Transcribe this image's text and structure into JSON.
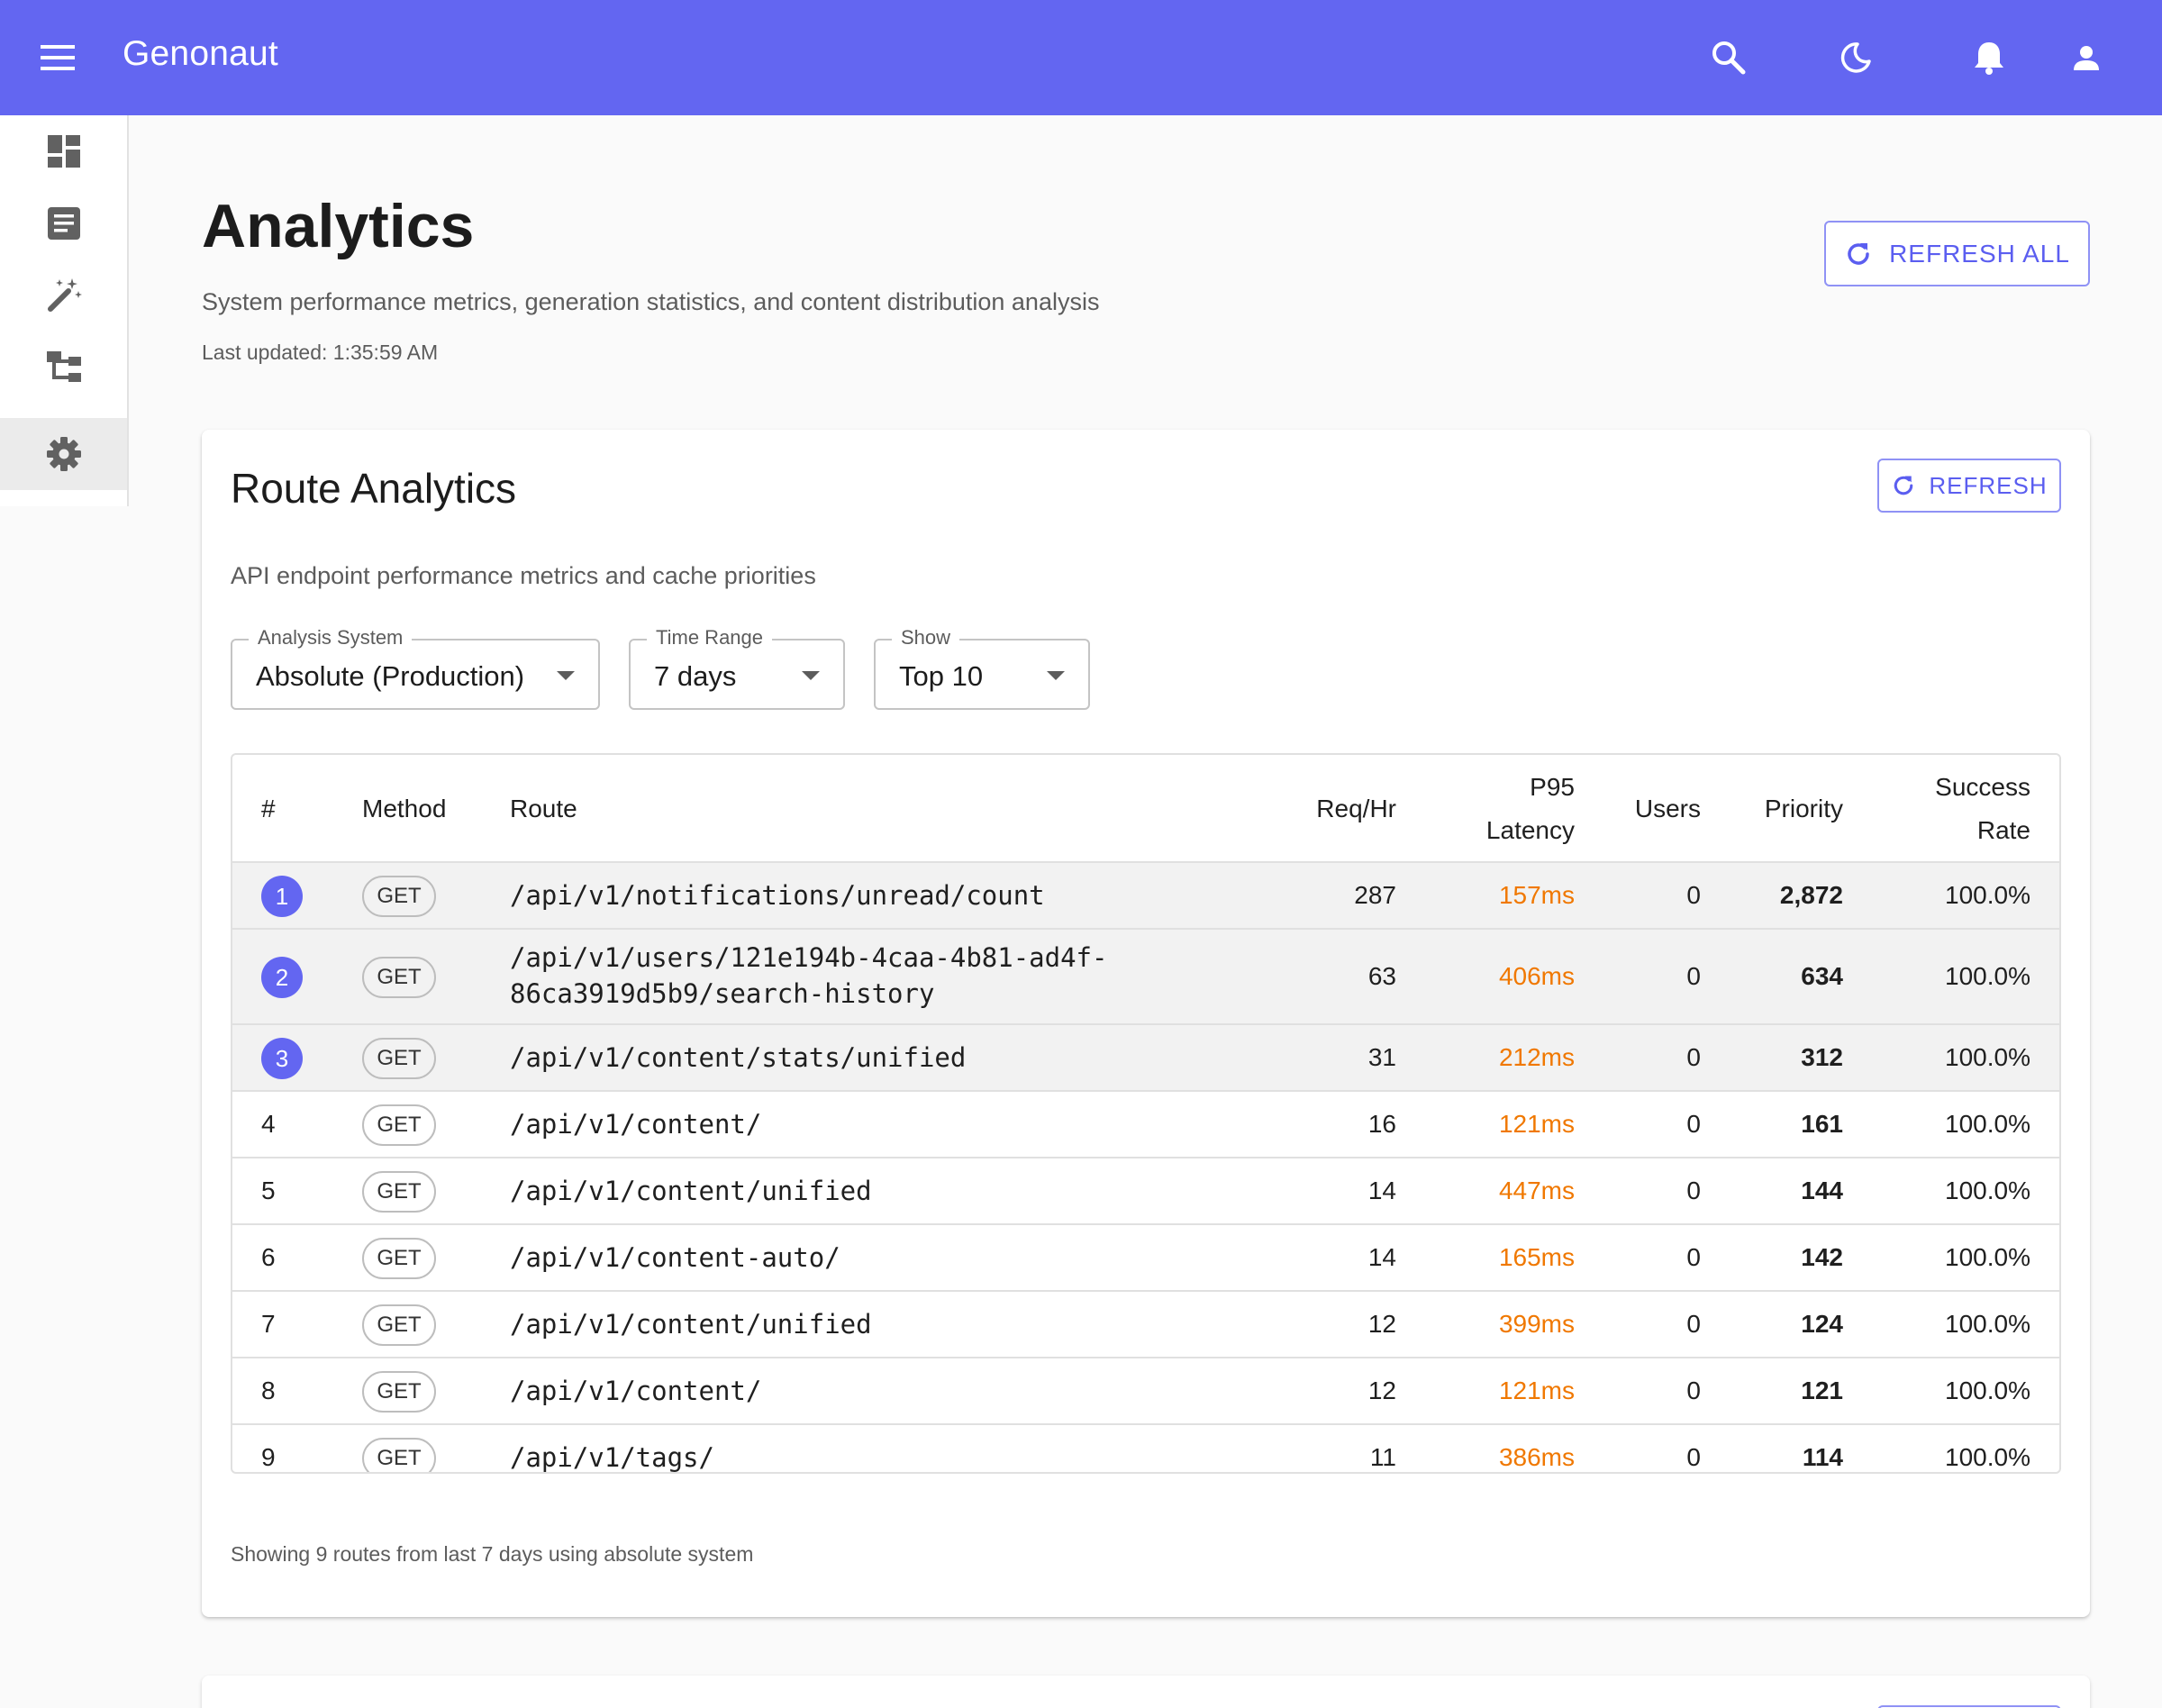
{
  "app": {
    "title": "Genonaut",
    "icons": [
      "menu-icon",
      "search-icon",
      "dark-mode-icon",
      "notifications-icon",
      "account-icon"
    ]
  },
  "sidebar": {
    "items": [
      {
        "icon": "dashboard-icon"
      },
      {
        "icon": "article-icon"
      },
      {
        "icon": "magic-wand-icon"
      },
      {
        "icon": "hierarchy-icon"
      },
      {
        "icon": "settings-icon",
        "active": true
      }
    ]
  },
  "page": {
    "title": "Analytics",
    "subtitle": "System performance metrics, generation statistics, and content distribution analysis",
    "last_updated": "Last updated: 1:35:59 AM",
    "refresh_all_label": "REFRESH ALL"
  },
  "route_analytics": {
    "title": "Route Analytics",
    "refresh_label": "REFRESH",
    "subtitle": "API endpoint performance metrics and cache priorities",
    "filters": {
      "analysis_system": {
        "label": "Analysis System",
        "value": "Absolute (Production)"
      },
      "time_range": {
        "label": "Time Range",
        "value": "7 days"
      },
      "show": {
        "label": "Show",
        "value": "Top 10"
      }
    },
    "columns": {
      "rank": "#",
      "method": "Method",
      "route": "Route",
      "req_hr": "Req/Hr",
      "p95_line1": "P95",
      "p95_line2": "Latency",
      "users": "Users",
      "priority": "Priority",
      "success_line1": "Success",
      "success_line2": "Rate"
    },
    "rows": [
      {
        "rank": "1",
        "method": "GET",
        "route_line1": "/api/v1/notifications/unread/count",
        "route_line2": "",
        "req_hr": "287",
        "latency": "157ms",
        "users": "0",
        "priority": "2,872",
        "success": "100.0%"
      },
      {
        "rank": "2",
        "method": "GET",
        "route_line1": "/api/v1/users/121e194b-4caa-4b81-ad4f-",
        "route_line2": "86ca3919d5b9/search-history",
        "req_hr": "63",
        "latency": "406ms",
        "users": "0",
        "priority": "634",
        "success": "100.0%"
      },
      {
        "rank": "3",
        "method": "GET",
        "route_line1": "/api/v1/content/stats/unified",
        "route_line2": "",
        "req_hr": "31",
        "latency": "212ms",
        "users": "0",
        "priority": "312",
        "success": "100.0%"
      },
      {
        "rank": "4",
        "method": "GET",
        "route_line1": "/api/v1/content/",
        "route_line2": "",
        "req_hr": "16",
        "latency": "121ms",
        "users": "0",
        "priority": "161",
        "success": "100.0%"
      },
      {
        "rank": "5",
        "method": "GET",
        "route_line1": "/api/v1/content/unified",
        "route_line2": "",
        "req_hr": "14",
        "latency": "447ms",
        "users": "0",
        "priority": "144",
        "success": "100.0%"
      },
      {
        "rank": "6",
        "method": "GET",
        "route_line1": "/api/v1/content-auto/",
        "route_line2": "",
        "req_hr": "14",
        "latency": "165ms",
        "users": "0",
        "priority": "142",
        "success": "100.0%"
      },
      {
        "rank": "7",
        "method": "GET",
        "route_line1": "/api/v1/content/unified",
        "route_line2": "",
        "req_hr": "12",
        "latency": "399ms",
        "users": "0",
        "priority": "124",
        "success": "100.0%"
      },
      {
        "rank": "8",
        "method": "GET",
        "route_line1": "/api/v1/content/",
        "route_line2": "",
        "req_hr": "12",
        "latency": "121ms",
        "users": "0",
        "priority": "121",
        "success": "100.0%"
      },
      {
        "rank": "9",
        "method": "GET",
        "route_line1": "/api/v1/tags/",
        "route_line2": "",
        "req_hr": "11",
        "latency": "386ms",
        "users": "0",
        "priority": "114",
        "success": "100.0%"
      }
    ],
    "footnote": "Showing 9 routes from last 7 days using absolute system"
  },
  "colors": {
    "brand": "#6366f1",
    "latency": "#f07800"
  }
}
